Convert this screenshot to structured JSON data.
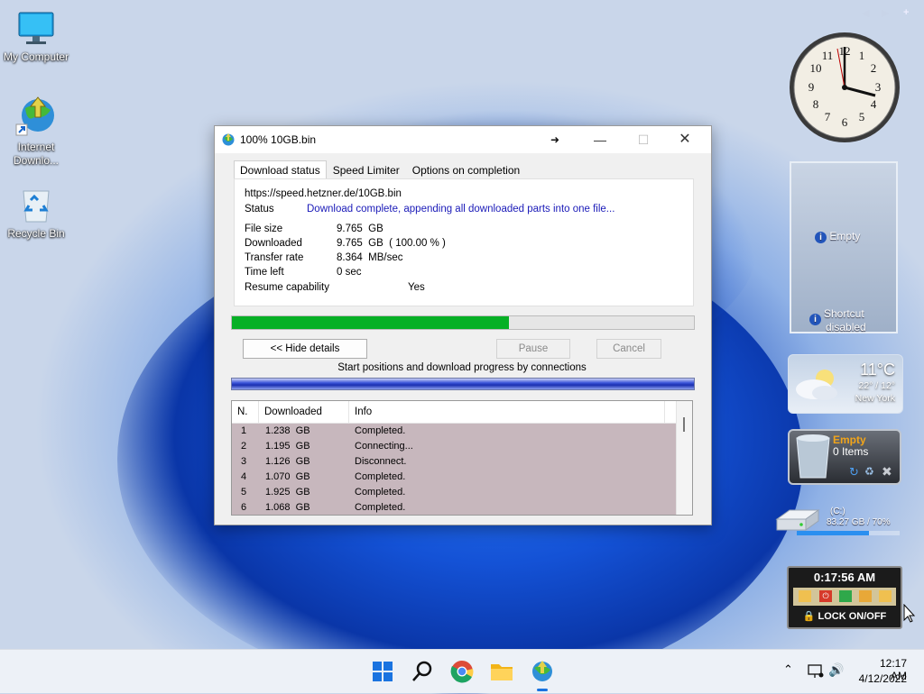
{
  "desktop": {
    "icons": [
      {
        "label": "My Computer"
      },
      {
        "label_line1": "Internet",
        "label_line2": "Downlo..."
      },
      {
        "label": "Recycle Bin"
      }
    ]
  },
  "dialog": {
    "title": "100% 10GB.bin",
    "tabs": [
      "Download status",
      "Speed Limiter",
      "Options on completion"
    ],
    "url": "https://speed.hetzner.de/10GB.bin",
    "status_label": "Status",
    "status_value": "Download complete, appending all downloaded parts into one file...",
    "file_size_label": "File size",
    "file_size_value": "9.765  GB",
    "downloaded_label": "Downloaded",
    "downloaded_value": "9.765  GB  ( 100.00 % )",
    "transfer_rate_label": "Transfer rate",
    "transfer_rate_value": "8.364  MB/sec",
    "time_left_label": "Time left",
    "time_left_value": "0 sec",
    "resume_label": "Resume capability",
    "resume_value": "Yes",
    "progress_fraction": 0.6,
    "hide_details_label": "<< Hide details",
    "pause_label": "Pause",
    "cancel_label": "Cancel",
    "connections_caption": "Start positions and download progress by connections",
    "table_headers": [
      "N.",
      "Downloaded",
      "Info"
    ],
    "connections": [
      {
        "n": "1",
        "downloaded": "1.238  GB",
        "info": "Completed."
      },
      {
        "n": "2",
        "downloaded": "1.195  GB",
        "info": "Connecting..."
      },
      {
        "n": "3",
        "downloaded": "1.126  GB",
        "info": "Disconnect."
      },
      {
        "n": "4",
        "downloaded": "1.070  GB",
        "info": "Completed."
      },
      {
        "n": "5",
        "downloaded": "1.925  GB",
        "info": "Completed."
      },
      {
        "n": "6",
        "downloaded": "1.068  GB",
        "info": "Completed."
      }
    ]
  },
  "gadgets": {
    "slideshow": {
      "empty_label": "Empty",
      "shortcut_line1": "Shortcut",
      "shortcut_line2": "disabled"
    },
    "weather": {
      "temp": "11°C",
      "range": "22° / 12°",
      "city": "New York"
    },
    "recycle": {
      "title": "Empty",
      "items": "0 Items"
    },
    "drive": {
      "label": "(C:)",
      "usage": "83.27 GB / 70%",
      "fill_fraction": 0.7
    },
    "lock": {
      "time": "0:17:56 AM",
      "label": "LOCK ON/OFF"
    }
  },
  "taskbar": {
    "time": "12:17 AM",
    "date": "4/12/2022"
  },
  "colors": {
    "progress_fill": "#06b025",
    "status_blue": "#1a1ab8",
    "row_bg": "#c7b7bd"
  }
}
